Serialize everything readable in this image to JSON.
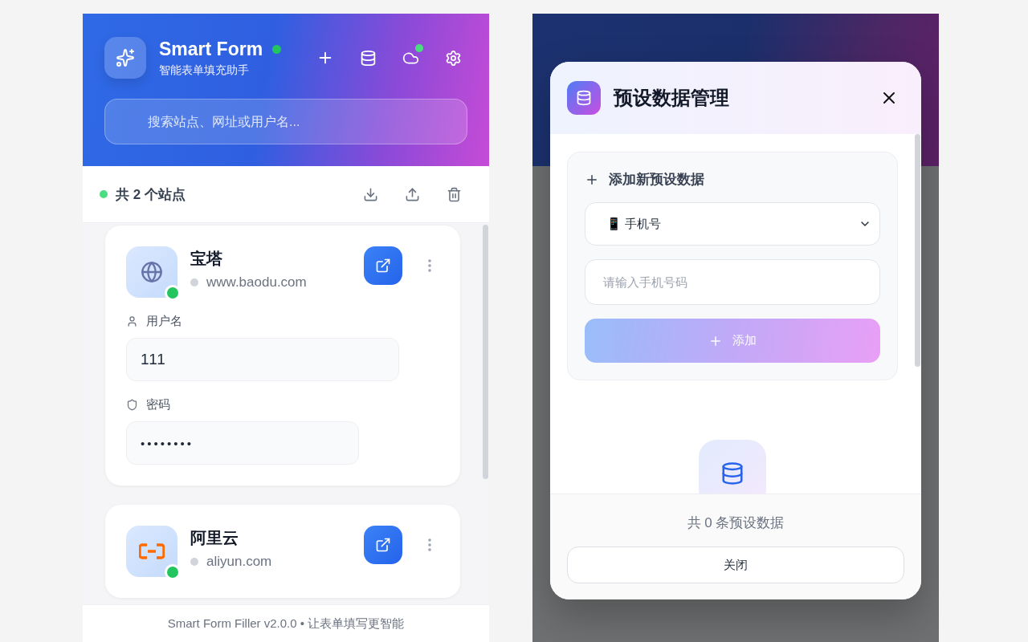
{
  "main_panel": {
    "header": {
      "title": "Smart Form",
      "online": true,
      "subtitle": "智能表单填充助手",
      "actions": [
        {
          "kind": "add",
          "badge": false
        },
        {
          "kind": "database",
          "badge": false
        },
        {
          "kind": "cloud",
          "badge": true
        },
        {
          "kind": "settings",
          "badge": false
        }
      ],
      "search": {
        "placeholder": "搜索站点、网址或用户名..."
      }
    },
    "summary": {
      "text": "共 2 个站点",
      "tools": [
        {
          "kind": "download"
        },
        {
          "kind": "upload"
        },
        {
          "kind": "delete"
        }
      ]
    },
    "sites": [
      {
        "name": "宝塔",
        "url": "www.baodu.com",
        "kind": "globe",
        "online": true,
        "fields": [
          {
            "kind": "user",
            "label": "用户名",
            "value": "111"
          },
          {
            "kind": "password",
            "label": "密码",
            "value": "••••••••"
          }
        ]
      },
      {
        "name": "阿里云",
        "url": "aliyun.com",
        "kind": "brackets",
        "online": true
      }
    ],
    "footer": "Smart Form Filler v2.0.0 • 让表单填写更智能"
  },
  "preset_dialog": {
    "title": "预设数据管理",
    "add_section": {
      "heading": "添加新预设数据",
      "type_select": {
        "value": "📱 手机号"
      },
      "input": {
        "placeholder": "请输入手机号码"
      },
      "add_button": {
        "label": "添加",
        "disabled": true
      }
    },
    "count": "共 0 条预设数据",
    "close_button": "关闭"
  }
}
